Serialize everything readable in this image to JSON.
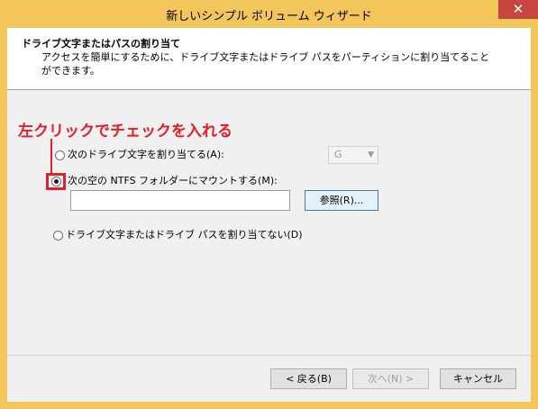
{
  "window": {
    "title": "新しいシンプル ボリューム ウィザード",
    "close_glyph": "✕"
  },
  "header": {
    "title": "ドライブ文字またはパスの割り当て",
    "description": "アクセスを簡単にするために、ドライブ文字またはドライブ パスをパーティションに割り当てることができます。"
  },
  "annotation": {
    "text": "左クリックでチェックを入れる",
    "color": "#e0202a"
  },
  "options": {
    "assign_letter": {
      "label": "次のドライブ文字を割り当てる(A):",
      "selected": false
    },
    "mount_folder": {
      "label": "次の空の NTFS フォルダーにマウントする(M):",
      "selected": true
    },
    "no_assign": {
      "label": "ドライブ文字またはドライブ パスを割り当てない(D)",
      "selected": false
    }
  },
  "drive_letter": {
    "value": "G",
    "enabled": false
  },
  "mount_path": {
    "value": ""
  },
  "buttons": {
    "browse": "参照(R)...",
    "back": "< 戻る(B)",
    "next": "次へ(N) >",
    "cancel": "キャンセル"
  }
}
